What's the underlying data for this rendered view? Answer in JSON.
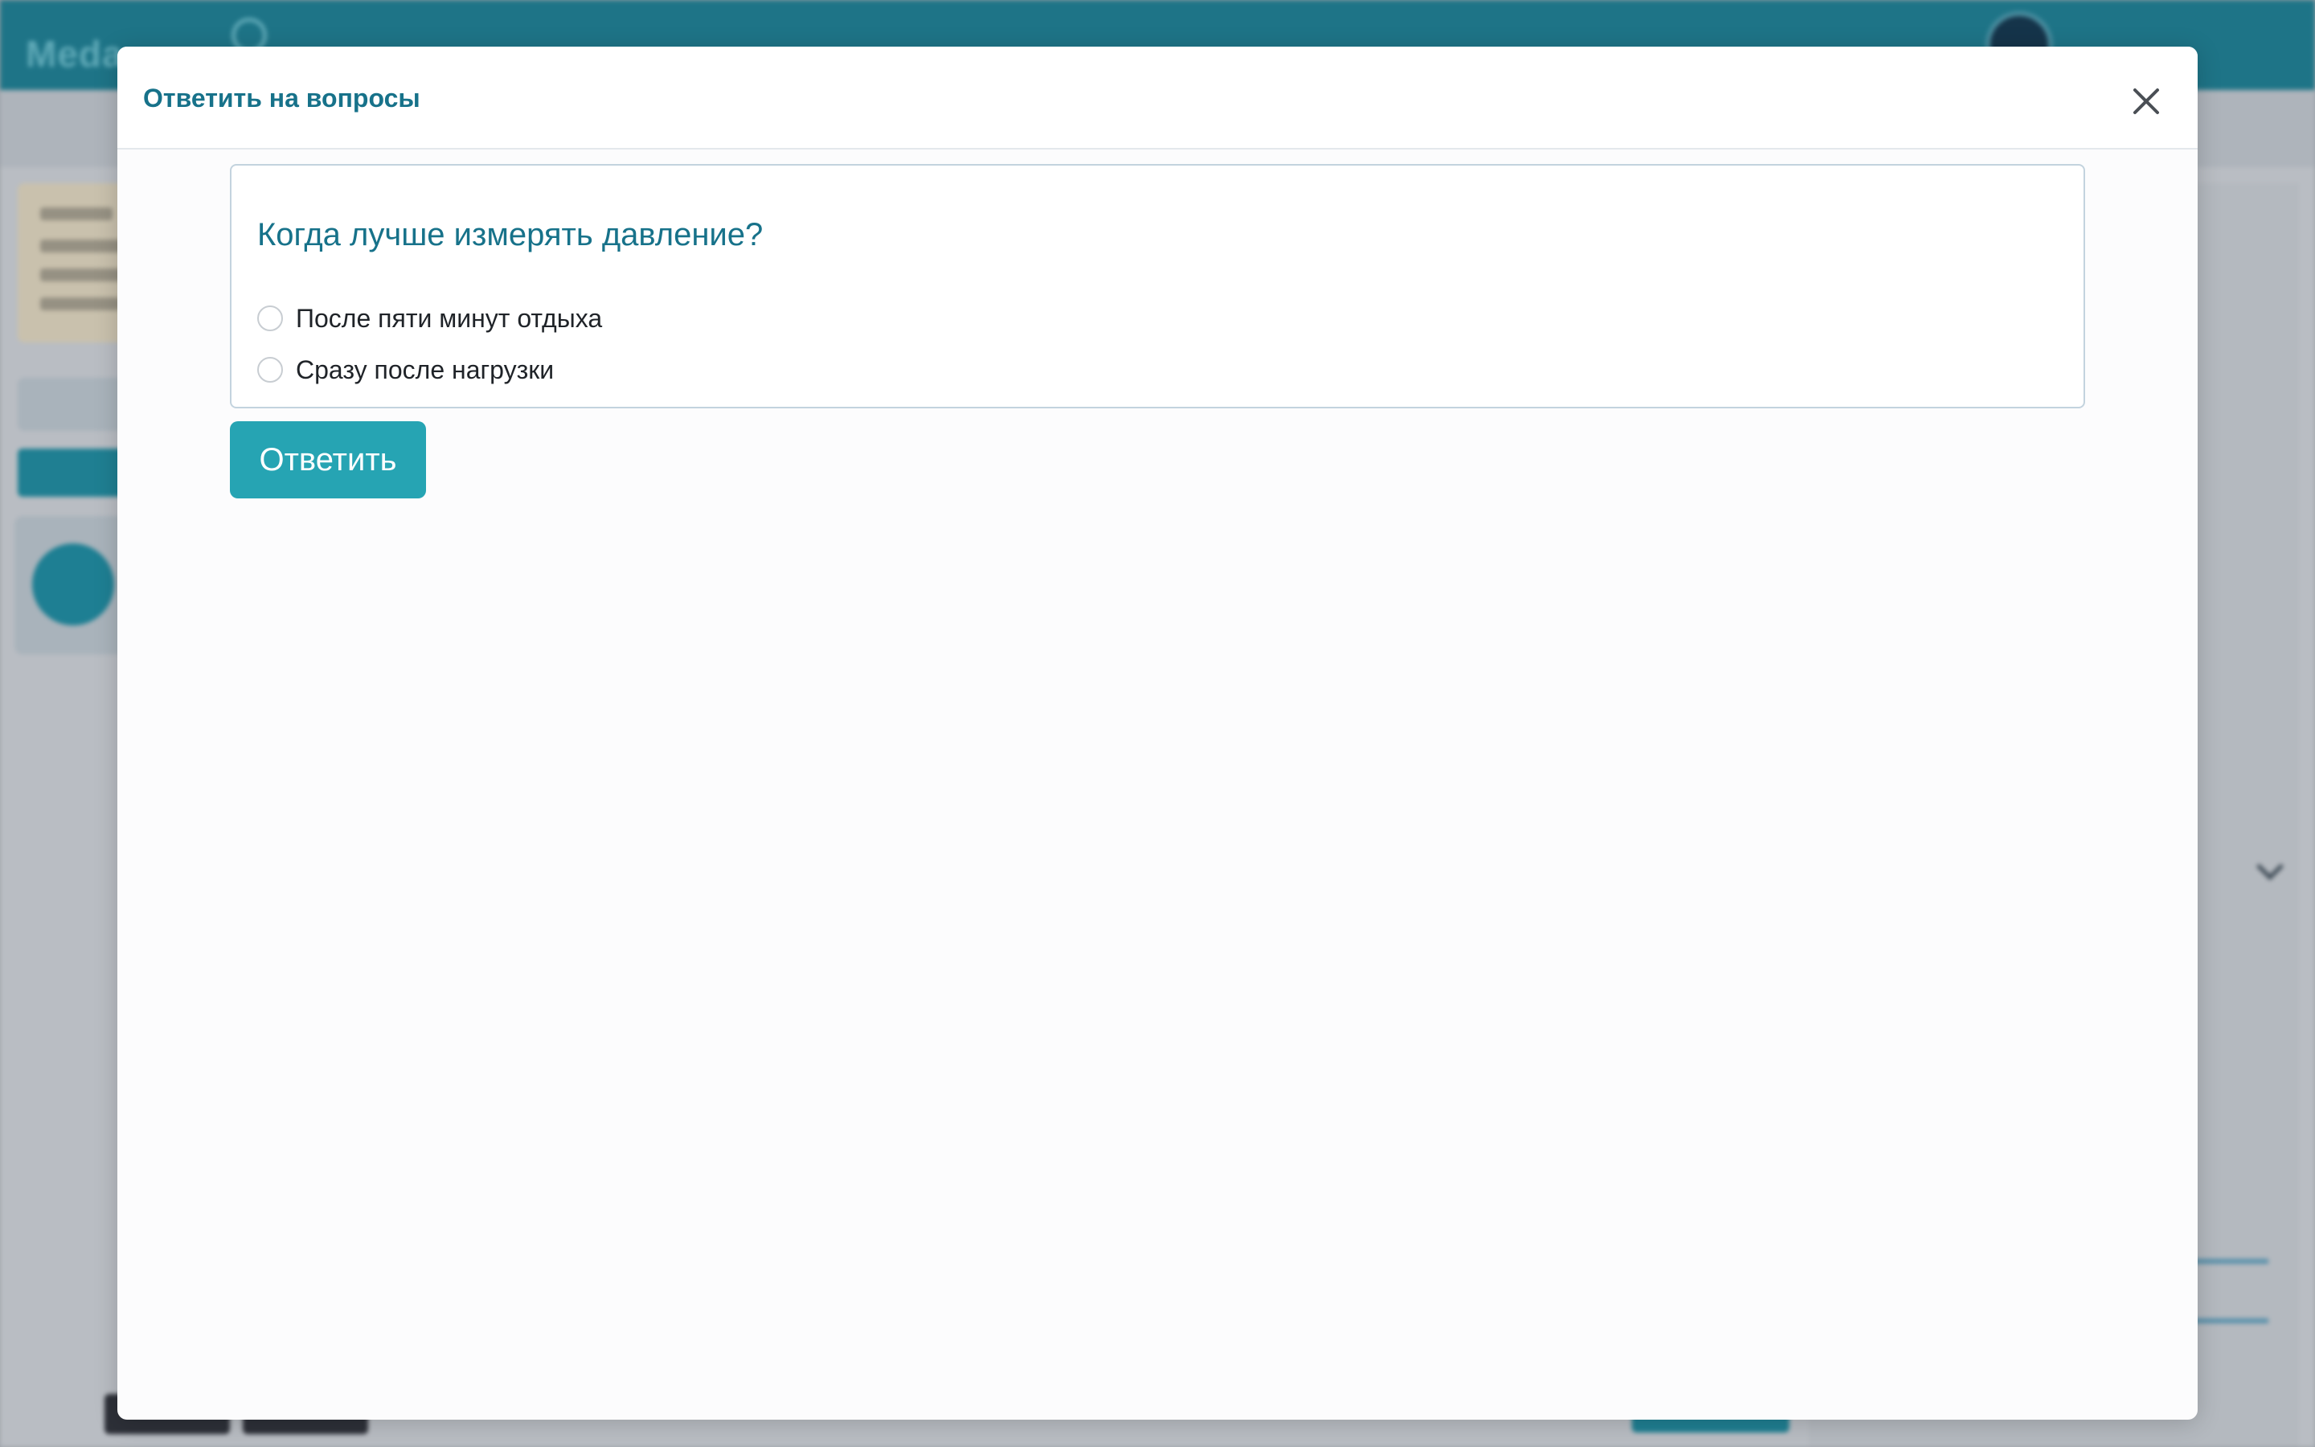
{
  "modal": {
    "title": "Ответить на вопросы",
    "close_icon": "close-icon",
    "question": {
      "text": "Когда лучше измерять давление?",
      "options": [
        {
          "label": "После пяти минут отдыха",
          "selected": false
        },
        {
          "label": "Сразу после нагрузки",
          "selected": false
        }
      ]
    },
    "submit_label": "Ответить"
  },
  "colors": {
    "accent": "#17728a",
    "button": "#26a4b3",
    "header_bar": "#1e7487"
  }
}
